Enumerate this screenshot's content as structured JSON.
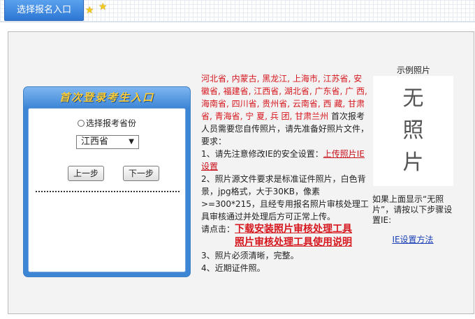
{
  "top_bar": {
    "tab_label": "选择报名入口"
  },
  "login": {
    "title": "首次登录考生入口",
    "radio_label": "选择报考省份",
    "province_selected": "江西省",
    "prev_label": "上一步",
    "next_label": "下一步"
  },
  "instructions": {
    "provinces": "河北省, 内蒙古, 黑龙江, 上海市, 江苏省, 安徽省, 福建省, 江西省, 湖北省, 广东省, 广  西, 海南省, 四川省, 贵州省, 云南省, 西  藏, 甘肃省, 青海省, 宁  夏, 兵  团, 甘肃兰州",
    "intro": " 首次报考人员需要您自传照片，请先准备好照片文件，要求：",
    "item1_prefix": "1、请先注意修改IE的安全设置：",
    "item1_link": "上传照片IE设置",
    "item2": "2、照片源文件要求是标准证件照片，白色背景，jpg格式，大于30KB，像素>=300*215，且经专用报名照片审核处理工具审核通过并处理后方可正常上传。",
    "click_label": "请点击：",
    "download_link": "下载安装照片审核处理工具",
    "manual_link": "照片审核处理工具使用说明",
    "item3": "3、照片必须清晰，完整。",
    "item4": "4、近期证件照。"
  },
  "example": {
    "title": "示例照片",
    "photo_line1": "无",
    "photo_line2": "照",
    "photo_line3": "片",
    "note": "如果上面显示“无照片”，请按以下步骤设置IE:",
    "ie_link": "IE设置方法"
  }
}
